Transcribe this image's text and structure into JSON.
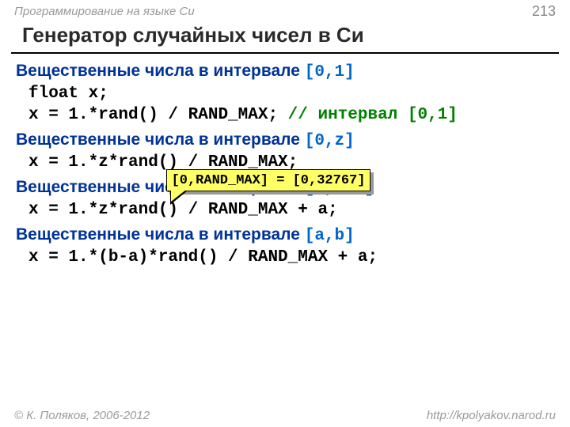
{
  "header": {
    "course": "Программирование на языке Си",
    "page": "213"
  },
  "title": "Генератор случайных чисел в Си",
  "sec1": {
    "head": "Вещественные числа в интервале ",
    "range": "[0,1]",
    "decl": "float x;",
    "callout": "[0,RAND_MAX] = [0,32767]",
    "code": "x = 1.*rand() / RAND_MAX; ",
    "comment": "// интервал [0,1]"
  },
  "sec2": {
    "head": "Вещественные числа в интервале ",
    "range": "[0,z]",
    "code": "x = 1.*z*rand() / RAND_MAX;"
  },
  "sec3": {
    "head": "Вещественные числа в интервале ",
    "range": "[a,z+a]",
    "code": "x = 1.*z*rand() / RAND_MAX + a;"
  },
  "sec4": {
    "head": "Вещественные числа в интервале ",
    "range": "[a,b]",
    "code": "x = 1.*(b-a)*rand() / RAND_MAX + a;"
  },
  "footer": {
    "copyright": "© К. Поляков, 2006-2012",
    "url": "http://kpolyakov.narod.ru"
  }
}
